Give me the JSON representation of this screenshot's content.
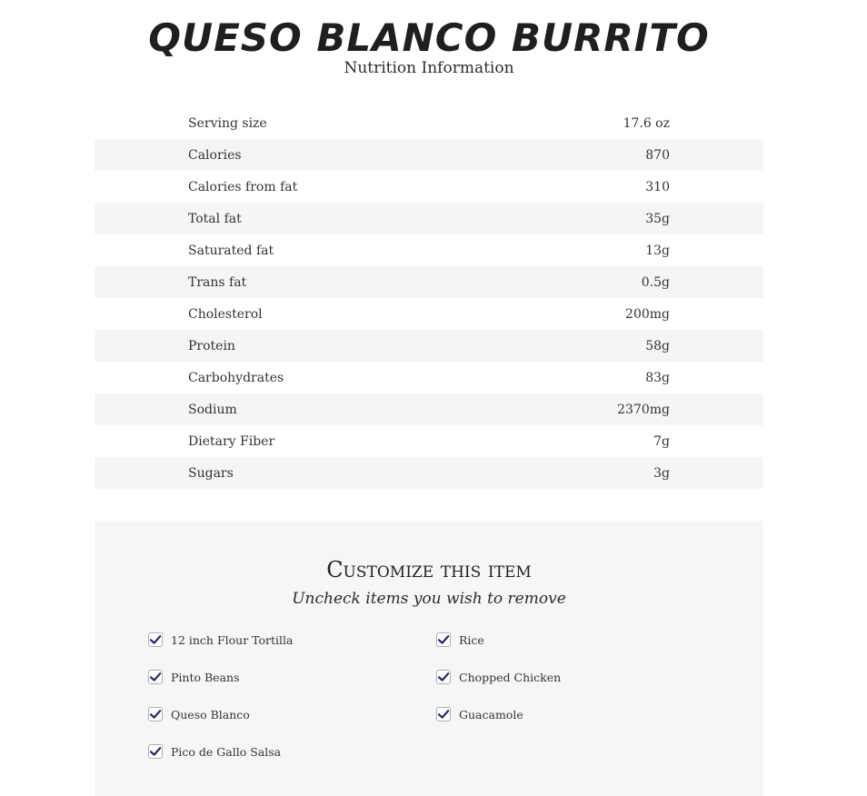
{
  "header": {
    "title": "QUESO BLANCO BURRITO",
    "subtitle": "Nutrition Information"
  },
  "nutrition": [
    {
      "label": "Serving size",
      "value": "17.6 oz"
    },
    {
      "label": "Calories",
      "value": "870"
    },
    {
      "label": "Calories from fat",
      "value": "310"
    },
    {
      "label": "Total fat",
      "value": "35g"
    },
    {
      "label": "Saturated fat",
      "value": "13g"
    },
    {
      "label": "Trans fat",
      "value": "0.5g"
    },
    {
      "label": "Cholesterol",
      "value": "200mg"
    },
    {
      "label": "Protein",
      "value": "58g"
    },
    {
      "label": "Carbohydrates",
      "value": "83g"
    },
    {
      "label": "Sodium",
      "value": "2370mg"
    },
    {
      "label": "Dietary Fiber",
      "value": "7g"
    },
    {
      "label": "Sugars",
      "value": "3g"
    }
  ],
  "customize": {
    "title": "Customize this item",
    "subtitle": "Uncheck items you wish to remove",
    "left_options": [
      {
        "label": "12 inch Flour Tortilla",
        "checked": true
      },
      {
        "label": "Pinto Beans",
        "checked": true
      },
      {
        "label": "Queso Blanco",
        "checked": true
      },
      {
        "label": "Pico de Gallo Salsa",
        "checked": true
      }
    ],
    "right_options": [
      {
        "label": "Rice",
        "checked": true
      },
      {
        "label": "Chopped Chicken",
        "checked": true
      },
      {
        "label": "Guacamole",
        "checked": true
      }
    ],
    "check_color": "#1d2a6b",
    "icon": "checkmark-icon"
  }
}
